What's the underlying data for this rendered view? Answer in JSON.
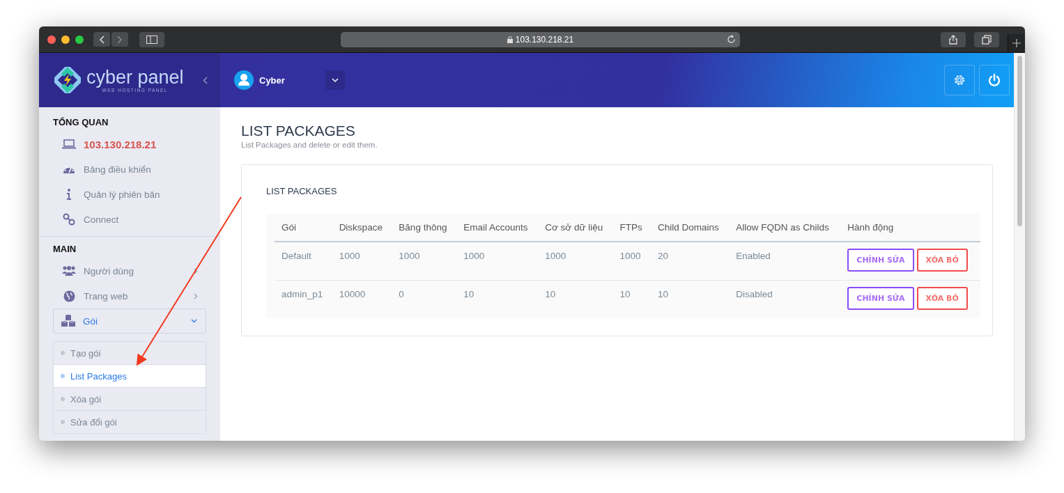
{
  "browser": {
    "url": "103.130.218.21"
  },
  "brand": {
    "name": "cyber panel",
    "tagline": "WEB HOSTING PANEL"
  },
  "user": {
    "name": "Cyber"
  },
  "sidebar": {
    "sections": [
      {
        "title": "TỔNG QUAN",
        "items": [
          {
            "label": "103.130.218.21",
            "kind": "highlight"
          },
          {
            "label": "Bảng điều khiển",
            "kind": "link"
          },
          {
            "label": "Quản lý phiên bản",
            "kind": "link"
          },
          {
            "label": "Connect",
            "kind": "link"
          }
        ]
      },
      {
        "title": "MAIN",
        "items": [
          {
            "label": "Người dùng",
            "kind": "group",
            "expanded": false
          },
          {
            "label": "Trang web",
            "kind": "group",
            "expanded": false
          },
          {
            "label": "Gói",
            "kind": "group",
            "expanded": true,
            "children": [
              {
                "label": "Tạo gói",
                "selected": false
              },
              {
                "label": "List Packages",
                "selected": true
              },
              {
                "label": "Xóa gói",
                "selected": false
              },
              {
                "label": "Sửa đổi gói",
                "selected": false
              }
            ]
          }
        ]
      }
    ]
  },
  "page": {
    "title": "LIST PACKAGES",
    "subtitle": "List Packages and delete or edit them."
  },
  "card": {
    "title": "LIST PACKAGES"
  },
  "table": {
    "columns": [
      "Gói",
      "Diskspace",
      "Băng thông",
      "Email Accounts",
      "Cơ sở dữ liệu",
      "FTPs",
      "Child Domains",
      "Allow FQDN as Childs",
      "Hành động"
    ],
    "rows": [
      {
        "cells": [
          "Default",
          "1000",
          "1000",
          "1000",
          "1000",
          "1000",
          "20",
          "Enabled"
        ],
        "actions": [
          {
            "label": "CHỈNH SỬA",
            "kind": "edit"
          },
          {
            "label": "XÓA BỎ",
            "kind": "delete"
          }
        ]
      },
      {
        "cells": [
          "admin_p1",
          "10000",
          "0",
          "10",
          "10",
          "10",
          "10",
          "Disabled"
        ],
        "actions": [
          {
            "label": "CHỈNH SỬA",
            "kind": "edit"
          },
          {
            "label": "XÓA BỎ",
            "kind": "delete"
          }
        ]
      }
    ]
  }
}
